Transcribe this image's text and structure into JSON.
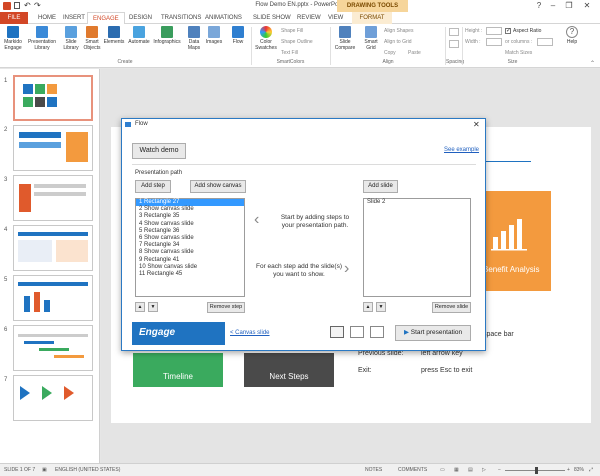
{
  "window": {
    "title": "Flow Demo EN.pptx - PowerPoint",
    "contextual_tab": "DRAWING TOOLS",
    "help": "?"
  },
  "tabs": [
    "FILE",
    "HOME",
    "INSERT",
    "ENGAGE",
    "DESIGN",
    "TRANSITIONS",
    "ANIMATIONS",
    "SLIDE SHOW",
    "REVIEW",
    "VIEW",
    "FORMAT"
  ],
  "ribbon": {
    "buttons": [
      "Markido Engage",
      "Presentation Library",
      "Slide Library",
      "Smart Objects",
      "Elements",
      "Automate",
      "Infographics",
      "Data Maps",
      "Images",
      "Flow",
      "Color Swatches",
      "Slide Compare",
      "Smart Grid",
      "Help"
    ],
    "smartcolors": [
      "Shape Fill",
      "Shape Outline",
      "Text Fill"
    ],
    "align": [
      "Align Shapes",
      "Align to Grid",
      "Copy",
      "Paste"
    ],
    "size": {
      "height_label": "Height :",
      "width_label": "Width :",
      "aspect": "Aspect Ratio",
      "columns": "or columns :",
      "match": "Match Sizes"
    },
    "groups": [
      "Create",
      "SmartColors",
      "Align",
      "Spacing",
      "Size"
    ]
  },
  "thumbnails": [
    "1",
    "2",
    "3",
    "4",
    "5",
    "6",
    "7"
  ],
  "slide": {
    "box_label": "Benefit Analysis",
    "timeline": "Timeline",
    "next_steps": "Next Steps",
    "space_bar": "space bar",
    "prev_label": "Previous slide:",
    "prev_value": "left arrow key",
    "exit_label": "Exit:",
    "exit_value": "press Esc to exit"
  },
  "dialog": {
    "title": "Flow",
    "watch_demo": "Watch demo",
    "see_example": "See example",
    "path_label": "Presentation path",
    "add_step": "Add step",
    "add_show_canvas": "Add show canvas",
    "add_slide": "Add slide",
    "steps": [
      "1   Rectangle 27",
      "2   Show canvas slide",
      "3   Rectangle 35",
      "4   Show canvas slide",
      "5   Rectangle 36",
      "6   Show canvas slide",
      "7   Rectangle 34",
      "8   Show canvas slide",
      "9   Rectangle 41",
      "10   Show canvas slide",
      "11   Rectangle 45"
    ],
    "slides": [
      "Slide 2"
    ],
    "hint1": "Start by adding steps to your presentation path.",
    "hint2": "For each step add the slide(s) you want to show.",
    "remove_step": "Remove step",
    "remove_slide": "Remove slide",
    "brand": "Engage",
    "canvas_slide": "< Canvas slide",
    "start": "Start presentation"
  },
  "status": {
    "slide": "SLIDE 1 OF 7",
    "lang": "ENGLISH (UNITED STATES)",
    "notes": "NOTES",
    "comments": "COMMENTS",
    "zoom": "83%"
  },
  "colors": {
    "accent": "#d24726",
    "orange": "#f39a3e",
    "green": "#3aaa5e",
    "dark": "#4a4a4a",
    "blue": "#1f73c1"
  }
}
